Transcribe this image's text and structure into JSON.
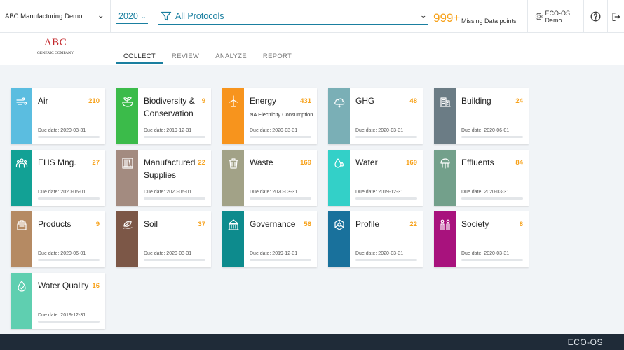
{
  "header": {
    "company": "ABC Manufacturing Demo",
    "year": "2020",
    "protocol": "All Protocols",
    "missing_count": "999+",
    "missing_label": "Missing Data points",
    "user": "ECO-OS Demo"
  },
  "logo": {
    "big": "ABC",
    "small": "GENERIC COMPANY"
  },
  "tabs": [
    "COLLECT",
    "REVIEW",
    "ANALYZE",
    "REPORT"
  ],
  "active_tab": "COLLECT",
  "cards": [
    {
      "title": "Air",
      "count": "210",
      "due": "Due date: 2020-03-31",
      "color": "#5bbde0",
      "icon": "wind-icon"
    },
    {
      "title": "Biodiversity & Conservation",
      "count": "9",
      "due": "Due date: 2019-12-31",
      "color": "#3bbb4a",
      "icon": "plant-bowl-icon"
    },
    {
      "title": "Energy",
      "count": "431",
      "subtitle": "NA Electricity Consumption",
      "due": "Due date: 2020-03-31",
      "color": "#f7941d",
      "icon": "wind-turbine-icon"
    },
    {
      "title": "GHG",
      "count": "48",
      "due": "Due date: 2020-03-31",
      "color": "#7aafb6",
      "icon": "cloud-icon"
    },
    {
      "title": "Building",
      "count": "24",
      "due": "Due date: 2020-06-01",
      "color": "#6b7c85",
      "icon": "building-icon"
    },
    {
      "title": "EHS Mng.",
      "count": "27",
      "due": "Due date: 2020-06-01",
      "color": "#12a195",
      "icon": "people-icon"
    },
    {
      "title": "Manufactured Supplies",
      "count": "22",
      "due": "Due date: 2020-06-01",
      "color": "#a38b80",
      "icon": "shelves-icon"
    },
    {
      "title": "Waste",
      "count": "169",
      "due": "Due date: 2020-03-31",
      "color": "#a2a287",
      "icon": "trash-bin-icon"
    },
    {
      "title": "Water",
      "count": "169",
      "due": "Due date: 2019-12-31",
      "color": "#33d0c8",
      "icon": "water-drops-icon"
    },
    {
      "title": "Effluents",
      "count": "84",
      "due": "Due date: 2020-03-31",
      "color": "#73a08b",
      "icon": "effluent-pipe-icon"
    },
    {
      "title": "Products",
      "count": "9",
      "due": "Due date: 2020-06-01",
      "color": "#b58a63",
      "icon": "package-icon"
    },
    {
      "title": "Soil",
      "count": "37",
      "due": "Due date: 2020-03-31",
      "color": "#7c5747",
      "icon": "soil-leaf-icon"
    },
    {
      "title": "Governance",
      "count": "56",
      "due": "Due date: 2019-12-31",
      "color": "#0d8b8d",
      "icon": "government-icon"
    },
    {
      "title": "Profile",
      "count": "22",
      "due": "Due date: 2020-03-31",
      "color": "#19719c",
      "icon": "network-icon"
    },
    {
      "title": "Society",
      "count": "8",
      "due": "Due date: 2020-03-31",
      "color": "#a8127d",
      "icon": "society-people-icon"
    },
    {
      "title": "Water Quality",
      "count": "16",
      "due": "Due date: 2019-12-31",
      "color": "#5fcfb0",
      "icon": "water-quality-icon"
    }
  ],
  "footer": {
    "brand": "ECO-OS"
  }
}
